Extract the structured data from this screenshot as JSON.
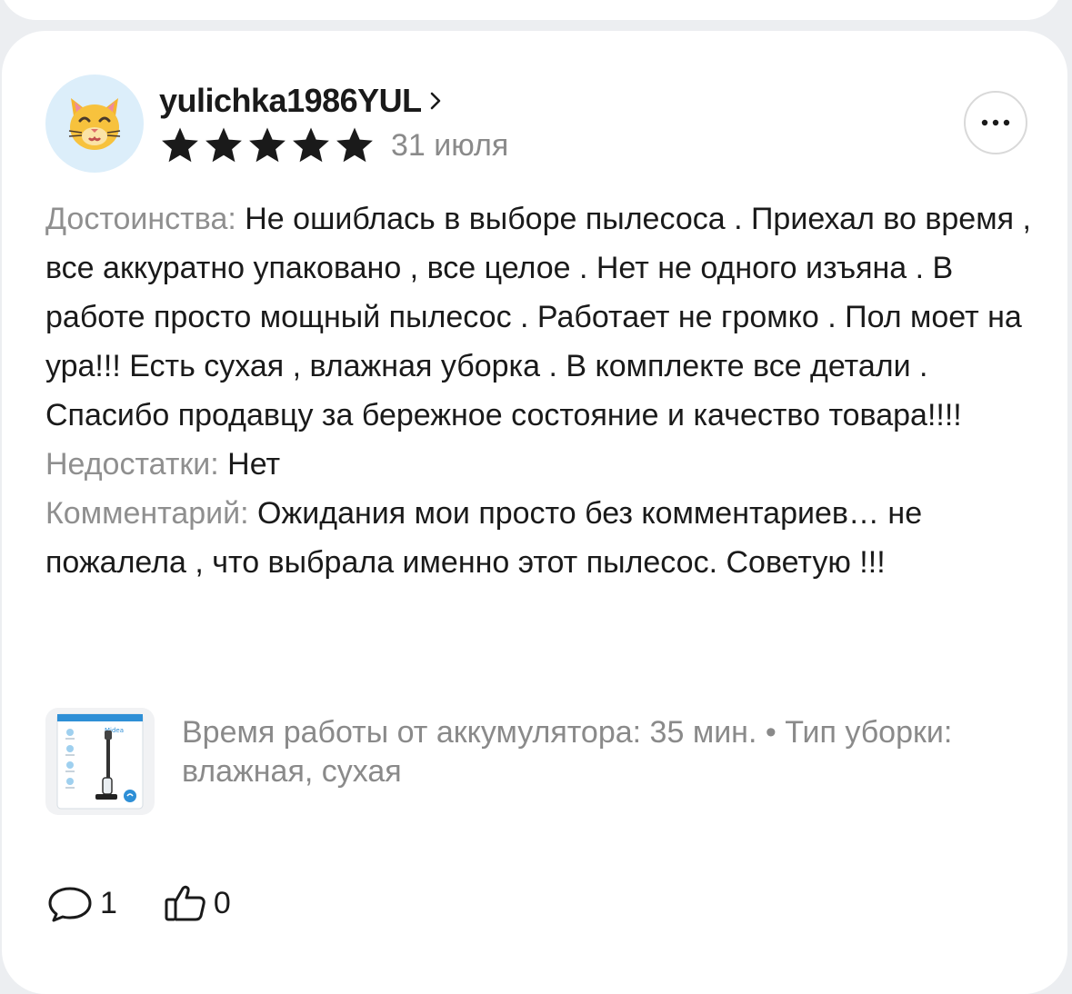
{
  "review": {
    "author": "yulichka1986YUL",
    "rating": 5,
    "max_rating": 5,
    "date": "31 июля",
    "pros_label": "Достоинства:",
    "pros_text": "Не ошиблась в выборе пылесоса . Приехал во время , все аккуратно упаковано , все целое . Нет не одного изъяна . В работе просто мощный пылесос . Работает не громко . Пол моет на ура!!! Есть сухая , влажная уборка . В комплекте все детали . Спасибо продавцу за бережное состояние и качество товара!!!!",
    "cons_label": "Недостатки:",
    "cons_text": "Нет",
    "comment_label": "Комментарий:",
    "comment_text": "Ожидания мои просто без комментариев… не пожалела , что выбрала именно этот пылесос. Советую !!!"
  },
  "product": {
    "specs": "Время работы от аккумулятора: 35 мин. • Тип уборки: влажная, сухая",
    "thumb_brand": "Midea"
  },
  "actions": {
    "comments_count": "1",
    "likes_count": "0"
  },
  "icons": {
    "avatar": "cat-face-icon",
    "chevron": "chevron-right-icon",
    "star": "star-icon",
    "more": "more-horizontal-icon",
    "comment": "comment-bubble-icon",
    "like": "thumbs-up-icon"
  },
  "colors": {
    "star": "#1a1a1a",
    "label_gray": "#8f8f8f",
    "avatar_bg": "#dceefa",
    "card_bg": "#ffffff",
    "page_bg": "#eceef1"
  }
}
